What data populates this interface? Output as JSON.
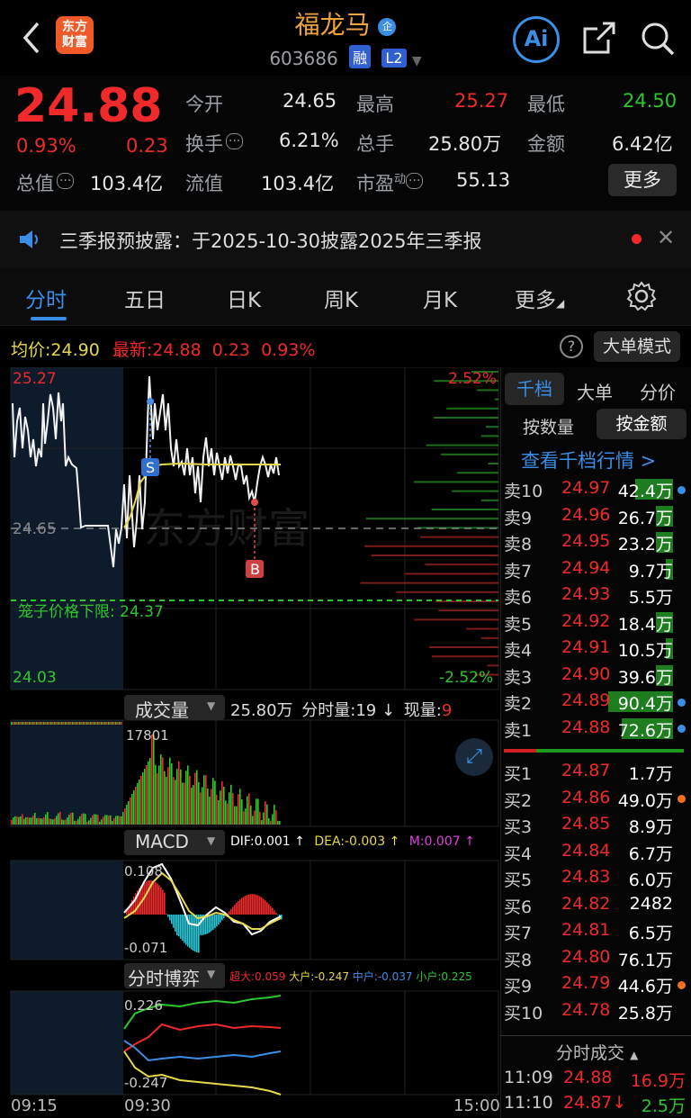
{
  "header": {
    "back_icon": "chevron-left-icon",
    "logo_text": "东方\n财富",
    "stock_name": "福龙马",
    "name_badge": "企",
    "stock_code": "603686",
    "tag_margin": "融",
    "tag_level": "L2",
    "ai_label": "Ai",
    "share_icon": "share-icon",
    "search_icon": "search-icon"
  },
  "quote": {
    "price": "24.88",
    "change_pct": "0.93%",
    "change": "0.23",
    "open_label": "今开",
    "open": "24.65",
    "high_label": "最高",
    "high": "25.27",
    "low_label": "最低",
    "low": "24.50",
    "turnover_label": "换手",
    "turnover": "6.21%",
    "volume_label": "总手",
    "volume": "25.80万",
    "amount_label": "金额",
    "amount": "6.42亿",
    "mcap_label": "总值",
    "mcap": "103.4亿",
    "float_label": "流值",
    "float": "103.4亿",
    "pe_label": "市盈",
    "pe_sup": "动",
    "pe": "55.13",
    "more_button": "更多"
  },
  "notice": {
    "text": "三季报预披露：于2025-10-30披露2025年三季报"
  },
  "tabs": [
    "分时",
    "五日",
    "日K",
    "周K",
    "月K",
    "更多"
  ],
  "chart_header": {
    "avg_label": "均价:",
    "avg": "24.90",
    "latest_label": "最新:",
    "latest": "24.88",
    "change": "0.23",
    "change_pct": "0.93%",
    "big_mode": "大单模式"
  },
  "intraday": {
    "y_top": "25.27",
    "y_mid": "24.65",
    "y_bottom": "24.03",
    "pct_top": "2.52%",
    "pct_bottom": "-2.52%",
    "cage_label": "笼子价格下限:",
    "cage_value": "24.37",
    "sell_marker": "S",
    "buy_marker": "B",
    "watermark": "东方财富"
  },
  "volume_panel": {
    "selector": "成交量",
    "total": "25.80万",
    "minute_label": "分时量:",
    "minute_value": "19 ↓",
    "current_label": "现量:",
    "current_value": "9",
    "peak": "17801"
  },
  "macd_panel": {
    "selector": "MACD",
    "dif": "DIF:0.001 ↑",
    "dea": "DEA:-0.003 ↑",
    "m": "M:0.007 ↑",
    "top": "0.108",
    "bottom": "-0.071"
  },
  "game_panel": {
    "selector": "分时博弈",
    "super": "超大:0.059",
    "big": "大户:-0.247",
    "mid": "中户:-0.037",
    "small": "小户:0.225",
    "top": "0.226",
    "bottom": "-0.247"
  },
  "time_axis": [
    "09:15",
    "09:30",
    "15:00"
  ],
  "orderbook": {
    "tabs": [
      "千档",
      "大单",
      "分价"
    ],
    "subtabs": [
      "按数量",
      "按金额"
    ],
    "link": "查看千档行情 >",
    "asks": [
      {
        "label": "卖10",
        "price": "24.97",
        "vol": "42.4万",
        "fill": 0.22
      },
      {
        "label": "卖9",
        "price": "24.96",
        "vol": "26.7万",
        "fill": 0.1
      },
      {
        "label": "卖8",
        "price": "24.95",
        "vol": "23.2万",
        "fill": 0.1
      },
      {
        "label": "卖7",
        "price": "24.94",
        "vol": "9.7万",
        "fill": 0.04
      },
      {
        "label": "卖6",
        "price": "24.93",
        "vol": "5.5万",
        "fill": 0.0
      },
      {
        "label": "卖5",
        "price": "24.92",
        "vol": "18.4万",
        "fill": 0.1
      },
      {
        "label": "卖4",
        "price": "24.91",
        "vol": "10.5万",
        "fill": 0.04
      },
      {
        "label": "卖3",
        "price": "24.90",
        "vol": "39.6万",
        "fill": 0.1
      },
      {
        "label": "卖2",
        "price": "24.89",
        "vol": "90.4万",
        "fill": 0.38
      },
      {
        "label": "卖1",
        "price": "24.88",
        "vol": "72.6万",
        "fill": 0.3
      }
    ],
    "bids": [
      {
        "label": "买1",
        "price": "24.87",
        "vol": "1.7万"
      },
      {
        "label": "买2",
        "price": "24.86",
        "vol": "49.0万"
      },
      {
        "label": "买3",
        "price": "24.85",
        "vol": "8.9万"
      },
      {
        "label": "买4",
        "price": "24.84",
        "vol": "6.7万"
      },
      {
        "label": "买5",
        "price": "24.83",
        "vol": "6.0万"
      },
      {
        "label": "买6",
        "price": "24.82",
        "vol": "2482"
      },
      {
        "label": "买7",
        "price": "24.81",
        "vol": "6.5万"
      },
      {
        "label": "买8",
        "price": "24.80",
        "vol": "76.1万"
      },
      {
        "label": "买9",
        "price": "24.79",
        "vol": "44.6万"
      },
      {
        "label": "买10",
        "price": "24.78",
        "vol": "25.8万"
      }
    ],
    "ticks_header": "分时成交",
    "ticks": [
      {
        "time": "11:09",
        "price": "24.88",
        "vol": "16.9万"
      },
      {
        "time": "11:10",
        "price": "24.87↓",
        "vol": "2.5万"
      }
    ]
  },
  "colors": {
    "up": "#f02a2a",
    "down": "#2ec82e",
    "accent": "#f0a33c",
    "avg": "#e5d84b",
    "blue": "#3a8ee6"
  }
}
